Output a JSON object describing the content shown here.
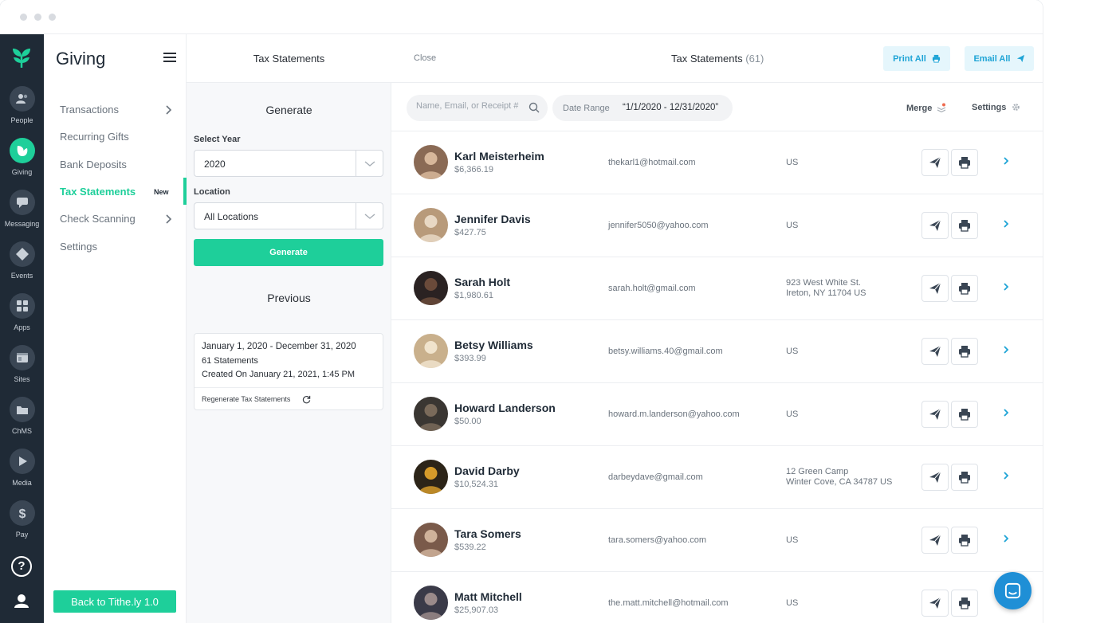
{
  "rail": {
    "items": [
      {
        "label": "People",
        "icon": "people-icon"
      },
      {
        "label": "Giving",
        "icon": "giving-leaf-icon",
        "active": true
      },
      {
        "label": "Messaging",
        "icon": "messaging-icon"
      },
      {
        "label": "Events",
        "icon": "events-icon"
      },
      {
        "label": "Apps",
        "icon": "apps-grid-icon"
      },
      {
        "label": "Sites",
        "icon": "sites-icon"
      },
      {
        "label": "ChMS",
        "icon": "folder-icon"
      },
      {
        "label": "Media",
        "icon": "play-icon"
      },
      {
        "label": "Pay",
        "icon": "dollar-icon"
      }
    ],
    "help": "?"
  },
  "nav": {
    "title": "Giving",
    "items": [
      {
        "label": "Transactions",
        "has_chevron": true
      },
      {
        "label": "Recurring Gifts"
      },
      {
        "label": "Bank Deposits"
      },
      {
        "label": "Tax Statements",
        "active": true,
        "badge": "New"
      },
      {
        "label": "Check Scanning",
        "has_chevron": true
      },
      {
        "label": "Settings"
      }
    ],
    "back_label": "Back to Tithe.ly 1.0"
  },
  "generate": {
    "header": "Tax Statements",
    "heading": "Generate",
    "year_label": "Select Year",
    "year_value": "2020",
    "location_label": "Location",
    "location_value": "All Locations",
    "button_label": "Generate",
    "previous_heading": "Previous",
    "previous": {
      "range": "January 1, 2020 - December 31, 2020",
      "count": "61 Statements",
      "created": "Created On January 21, 2021, 1:45 PM",
      "regen_label": "Regenerate Tax Statements"
    }
  },
  "main": {
    "close_label": "Close",
    "title": "Tax Statements",
    "count": "(61)",
    "print_all": "Print All",
    "email_all": "Email All",
    "search_placeholder": "Name, Email, or Receipt #",
    "date_label": "Date Range",
    "date_value": "“1/1/2020 - 12/31/2020”",
    "merge_label": "Merge",
    "settings_label": "Settings",
    "rows": [
      {
        "name": "Karl Meisterheim",
        "amount": "$6,366.19",
        "email": "thekarl1@hotmail.com",
        "address": [
          "US"
        ]
      },
      {
        "name": "Jennifer Davis",
        "amount": "$427.75",
        "email": "jennifer5050@yahoo.com",
        "address": [
          "US"
        ]
      },
      {
        "name": "Sarah Holt",
        "amount": "$1,980.61",
        "email": "sarah.holt@gmail.com",
        "address": [
          "923 West White St.",
          "Ireton, NY 11704 US"
        ]
      },
      {
        "name": "Betsy Williams",
        "amount": "$393.99",
        "email": "betsy.williams.40@gmail.com",
        "address": [
          "US"
        ]
      },
      {
        "name": "Howard Landerson",
        "amount": "$50.00",
        "email": "howard.m.landerson@yahoo.com",
        "address": [
          "US"
        ]
      },
      {
        "name": "David Darby",
        "amount": "$10,524.31",
        "email": "darbeydave@gmail.com",
        "address": [
          "12 Green Camp",
          "Winter Cove, CA 34787 US"
        ]
      },
      {
        "name": "Tara Somers",
        "amount": "$539.22",
        "email": "tara.somers@yahoo.com",
        "address": [
          "US"
        ]
      },
      {
        "name": "Matt Mitchell",
        "amount": "$25,907.03",
        "email": "the.matt.mitchell@hotmail.com",
        "address": [
          "US"
        ]
      }
    ]
  },
  "colors": {
    "accent": "#1ecf9a",
    "rail_bg": "#1f2a36",
    "link_blue": "#1ea4d6",
    "chat_blue": "#1f8fd6"
  }
}
